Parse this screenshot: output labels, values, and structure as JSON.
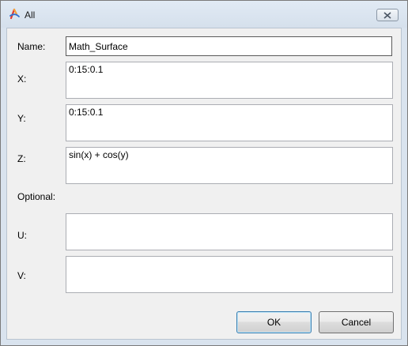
{
  "window": {
    "title": "All",
    "icons": {
      "app": "app-logo-icon",
      "close": "close-icon"
    }
  },
  "form": {
    "name_label": "Name:",
    "name_value": "Math_Surface",
    "x_label": "X:",
    "x_value": "0:15:0.1",
    "y_label": "Y:",
    "y_value": "0:15:0.1",
    "z_label": "Z:",
    "z_value": "sin(x) + cos(y)",
    "optional_label": "Optional:",
    "u_label": "U:",
    "u_value": "",
    "v_label": "V:",
    "v_value": ""
  },
  "buttons": {
    "ok_label": "OK",
    "cancel_label": "Cancel"
  }
}
